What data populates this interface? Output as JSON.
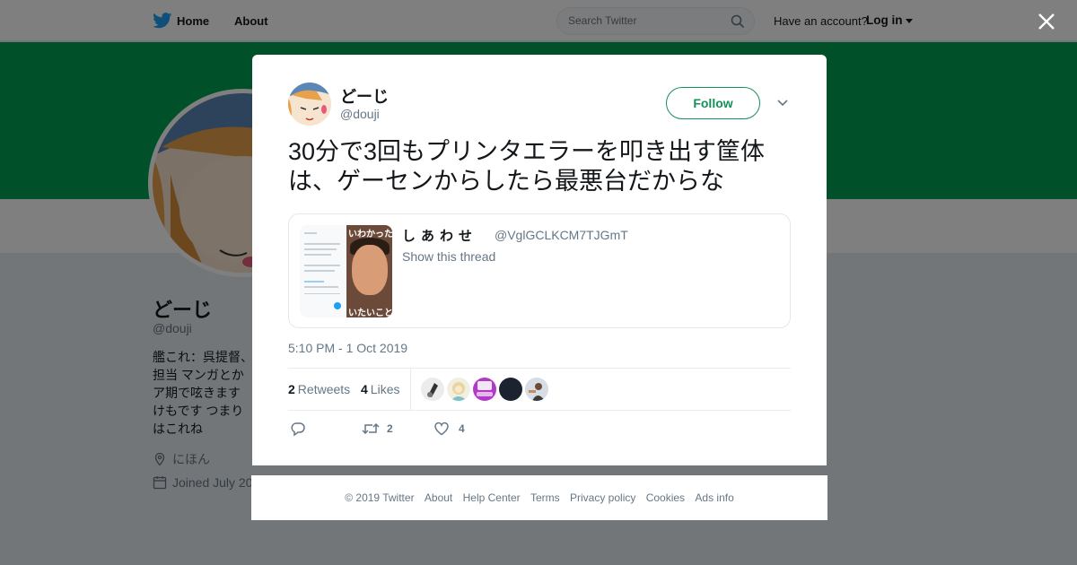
{
  "nav": {
    "home_label": "Home",
    "about_label": "About",
    "search_placeholder": "Search Twitter",
    "have_account": "Have an account?",
    "login_label": "Log in"
  },
  "profile": {
    "name": "どーじ",
    "handle": "@douji",
    "bio": "艦これ：呉提督、担当 マンガとかア期で呟きます けもです つまりはこれね",
    "location": "にほん",
    "joined": "Joined July 20"
  },
  "tweet": {
    "name": "どーじ",
    "handle": "@douji",
    "follow_label": "Follow",
    "text": "30分で3回もプリンタエラーを叩き出す筐体は、ゲーセンからしたら最悪台だからな",
    "quote": {
      "name": "しあわせ",
      "handle": "@VglGCLKCM7TJGmT",
      "thread_label": "Show this thread",
      "media_top_text": "いわかった",
      "media_bottom_text": "いたいこと"
    },
    "timestamp": "5:10 PM - 1 Oct 2019",
    "retweets_count": "2",
    "retweets_label": "Retweets",
    "likes_count": "4",
    "likes_label": "Likes",
    "action_retweet_count": "2",
    "action_like_count": "4"
  },
  "footer": {
    "links": [
      "© 2019 Twitter",
      "About",
      "Help Center",
      "Terms",
      "Privacy policy",
      "Cookies",
      "Ads info"
    ]
  },
  "colors": {
    "banner": "#00a352",
    "follow_accent": "#14915a",
    "twitter_blue": "#1da1f2",
    "text_secondary": "#657786"
  },
  "icons": [
    "twitter-bird-icon",
    "search-icon",
    "close-icon",
    "chevron-down-icon",
    "location-icon",
    "calendar-icon",
    "reply-icon",
    "retweet-icon",
    "heart-icon"
  ]
}
